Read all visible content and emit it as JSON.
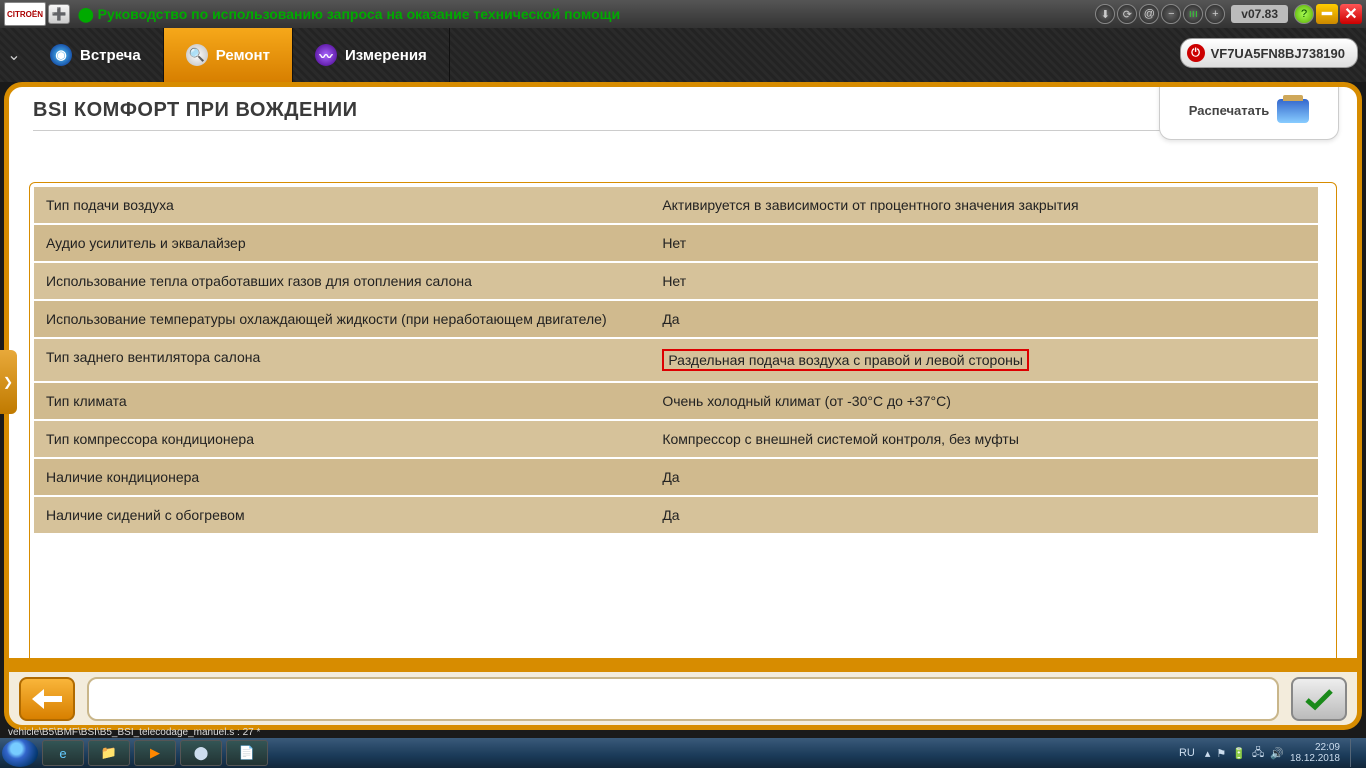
{
  "titlebar": {
    "title": "Руководство по использованию запроса на оказание технической помощи",
    "version": "v07.83",
    "brand": "CITROËN"
  },
  "tabs": {
    "meeting": "Встреча",
    "repair": "Ремонт",
    "measure": "Измерения"
  },
  "vin": "VF7UA5FN8BJ738190",
  "page": {
    "title": "BSI  КОМФОРТ ПРИ ВОЖДЕНИИ",
    "print_label": "Распечатать"
  },
  "rows": [
    {
      "label": "Тип подачи воздуха",
      "value": "Активируется в зависимости от процентного значения закрытия"
    },
    {
      "label": "Аудио усилитель и эквалайзер",
      "value": "Нет"
    },
    {
      "label": "Использование тепла отработавших газов для отопления салона",
      "value": "Нет"
    },
    {
      "label": "Использование температуры охлаждающей жидкости (при неработающем двигателе)",
      "value": "Да"
    },
    {
      "label": "Тип заднего вентилятора салона",
      "value": "Раздельная подача воздуха с правой и левой стороны",
      "highlight": true
    },
    {
      "label": "Тип климата",
      "value": "Очень холодный климат (от -30°C до +37°C)"
    },
    {
      "label": "Тип компрессора кондиционера",
      "value": "Компрессор с внешней системой контроля, без муфты"
    },
    {
      "label": "Наличие кондиционера",
      "value": "Да"
    },
    {
      "label": "Наличие сидений с обогревом",
      "value": "Да"
    }
  ],
  "status_path": "vehicle\\B5\\BMF\\BSI\\B5_BSI_telecodage_manuel.s : 27 *",
  "taskbar": {
    "lang": "RU",
    "time": "22:09",
    "date": "18.12.2018"
  }
}
